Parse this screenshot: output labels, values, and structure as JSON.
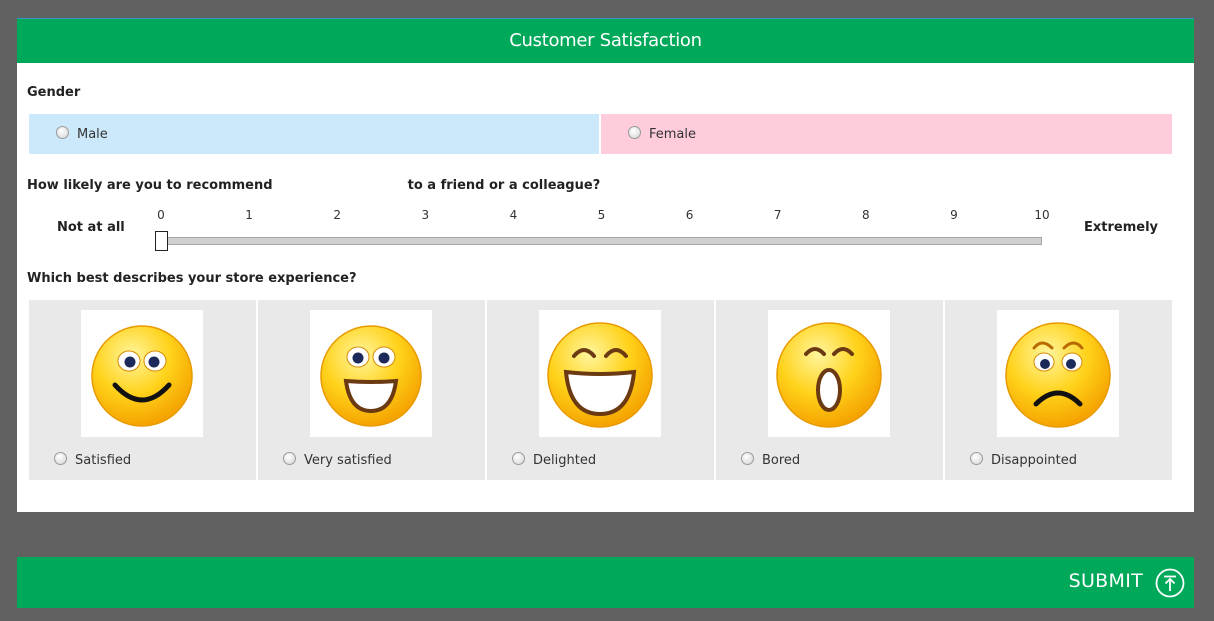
{
  "header": {
    "title": "Customer Satisfaction"
  },
  "gender": {
    "label": "Gender",
    "options": [
      {
        "label": "Male",
        "color": "#cce9fc"
      },
      {
        "label": "Female",
        "color": "#ffccdc"
      }
    ]
  },
  "recommend": {
    "label_start": "How likely are you to recommend",
    "label_end": "to a friend or a colleague?",
    "min_label": "Not at all",
    "max_label": "Extremely",
    "ticks": [
      "0",
      "1",
      "2",
      "3",
      "4",
      "5",
      "6",
      "7",
      "8",
      "9",
      "10"
    ],
    "value": 0
  },
  "experience": {
    "label": "Which best describes your store experience?",
    "options": [
      {
        "label": "Satisfied",
        "icon": "smile-icon"
      },
      {
        "label": "Very satisfied",
        "icon": "grin-icon"
      },
      {
        "label": "Delighted",
        "icon": "laugh-icon"
      },
      {
        "label": "Bored",
        "icon": "yawn-icon"
      },
      {
        "label": "Disappointed",
        "icon": "sad-icon"
      }
    ]
  },
  "submit": {
    "label": "SUBMIT",
    "icon": "upload-arrow-icon"
  },
  "colors": {
    "accent": "#00a95a",
    "background": "#616161"
  }
}
